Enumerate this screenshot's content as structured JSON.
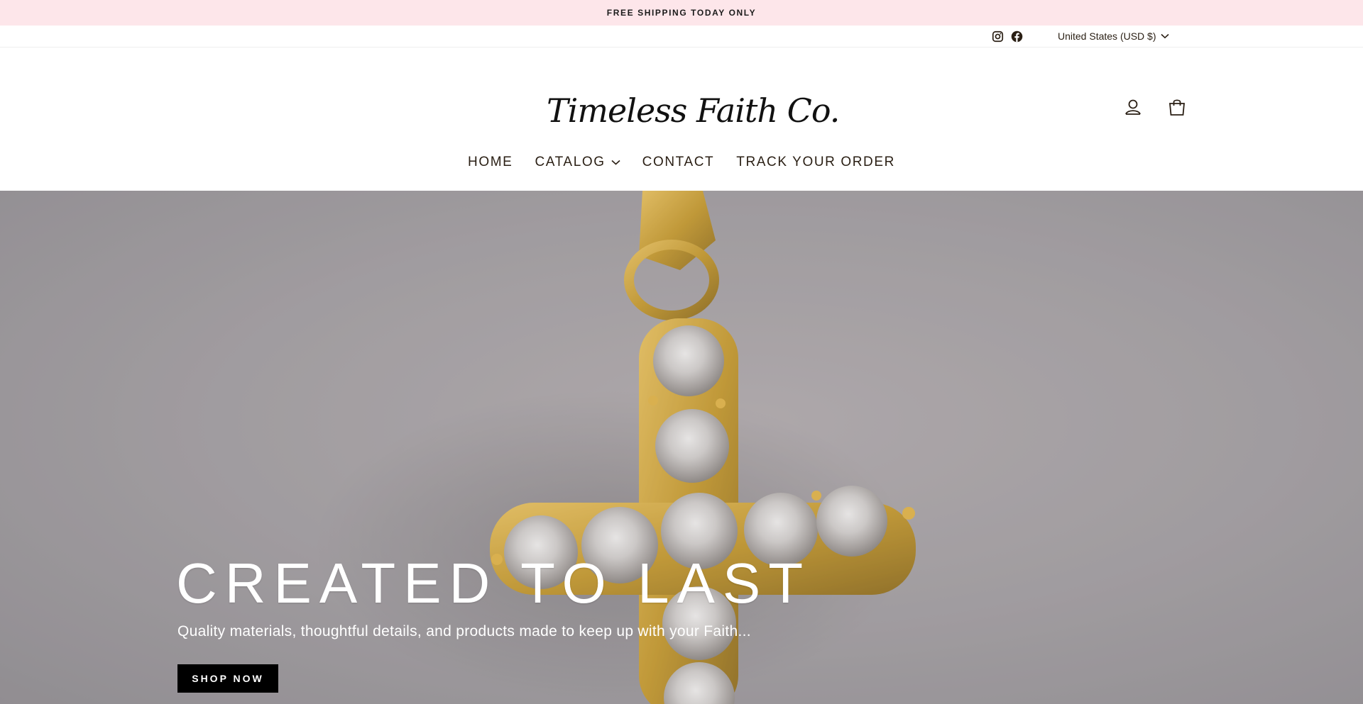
{
  "announcement": {
    "text": "FREE SHIPPING TODAY ONLY"
  },
  "utility": {
    "social": [
      {
        "icon": "instagram-icon"
      },
      {
        "icon": "facebook-icon"
      }
    ],
    "currency": {
      "label": "United States (USD $)",
      "icon": "chevron-down-icon"
    }
  },
  "header": {
    "logo": {
      "wordmark": "Timeless Faith Co.",
      "icon": "heart-cross-logo"
    },
    "icons": [
      {
        "icon": "account-icon"
      },
      {
        "icon": "cart-icon"
      }
    ]
  },
  "nav": {
    "items": [
      {
        "label": "HOME"
      },
      {
        "label": "CATALOG",
        "has_dropdown": true
      },
      {
        "label": "CONTACT"
      },
      {
        "label": "TRACK YOUR ORDER"
      }
    ]
  },
  "hero": {
    "title": "CREATED TO LAST",
    "subtitle": "Quality materials, thoughtful details, and products made to keep up with your Faith...",
    "button": "SHOP NOW"
  },
  "colors": {
    "announcement_bg": "#fde6ea",
    "text": "#2a1f14",
    "button_bg": "#000000",
    "logo_heart": "#e0454f",
    "pendant_gold": "#c99a24"
  }
}
